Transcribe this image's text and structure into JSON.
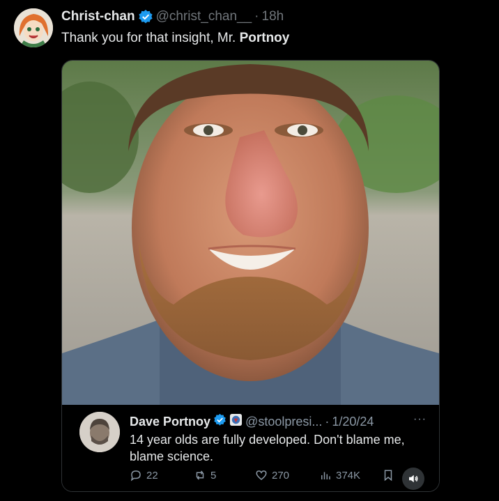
{
  "tweet": {
    "display_name": "Christ-chan",
    "handle": "@christ_chan__",
    "separator": "·",
    "time": "18h",
    "text_prefix": "Thank you for that insight, Mr. ",
    "text_bold": "Portnoy"
  },
  "quote": {
    "display_name": "Dave Portnoy",
    "handle": "@stoolpresi...",
    "separator": "·",
    "date": "1/20/24",
    "more": "···",
    "text": "14 year olds are fully developed. Don't blame me, blame science.",
    "replies": "22",
    "reposts": "5",
    "likes": "270",
    "views": "374K"
  },
  "colors": {
    "background": "#000000",
    "verified_blue": "#1d9bf0",
    "muted_text": "#71767b"
  },
  "icons": [
    "verified-badge-icon",
    "reply-icon",
    "repost-icon",
    "like-icon",
    "views-icon",
    "bookmark-icon",
    "sound-icon",
    "stool-logo-icon"
  ]
}
